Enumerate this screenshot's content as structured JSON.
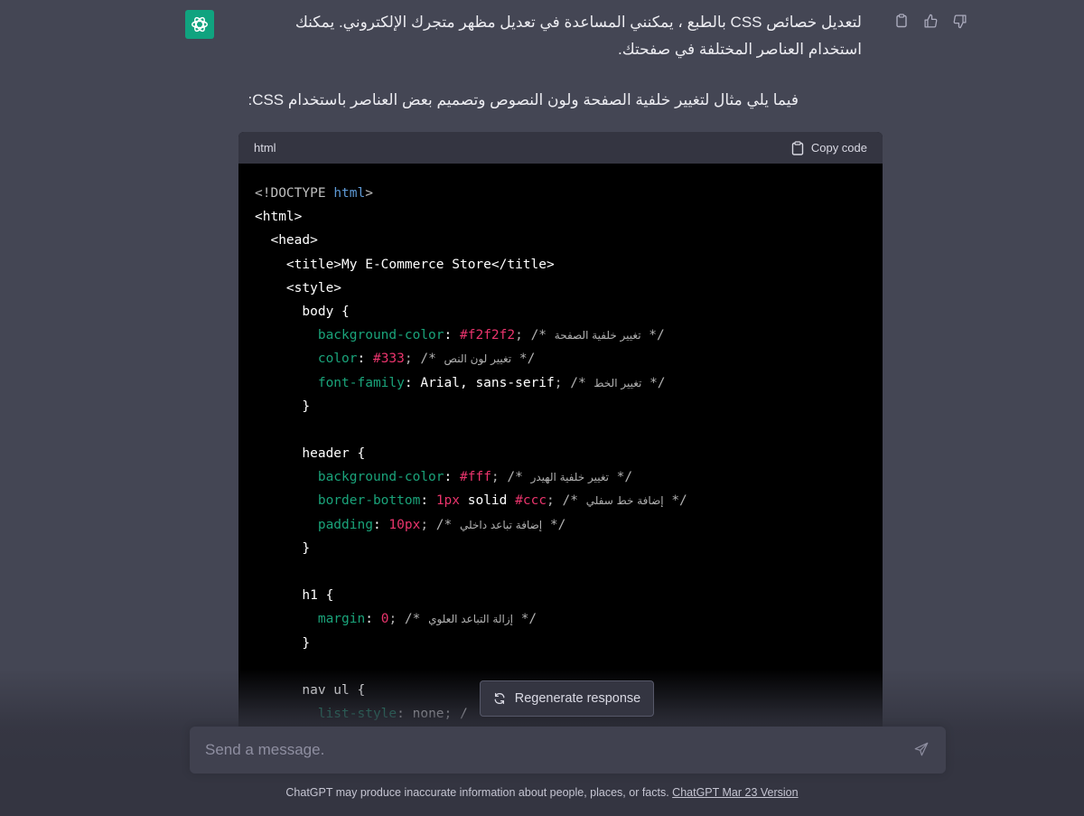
{
  "message": {
    "paragraph_1": "لتعديل خصائص CSS بالطبع ، يمكنني المساعدة في تعديل مظهر متجرك الإلكتروني. يمكنك استخدام العناصر المختلفة في صفحتك.",
    "paragraph_2": "فيما يلي مثال لتغيير خلفية الصفحة ولون النصوص وتصميم بعض العناصر باستخدام CSS:",
    "icons": [
      "openai-logo-icon",
      "clipboard-icon",
      "thumbs-up-icon",
      "thumbs-down-icon"
    ]
  },
  "code_block": {
    "language": "html",
    "copy_label": "Copy code",
    "lines": [
      [
        {
          "t": "<!DOCTYPE ",
          "c": "gray"
        },
        {
          "t": "html",
          "c": "blue"
        },
        {
          "t": ">",
          "c": "gray"
        }
      ],
      [
        {
          "t": "<html>",
          "c": "tag"
        }
      ],
      [
        {
          "t": "  <head>",
          "c": "tag"
        }
      ],
      [
        {
          "t": "    <title>My E-Commerce Store</title>",
          "c": "tag"
        }
      ],
      [
        {
          "t": "    <style>",
          "c": "tag"
        }
      ],
      [
        {
          "t": "      body {",
          "c": "plain"
        }
      ],
      [
        {
          "t": "        ",
          "c": "plain"
        },
        {
          "t": "background-color",
          "c": "prop"
        },
        {
          "t": ": ",
          "c": "plain"
        },
        {
          "t": "#f2f2f2",
          "c": "val"
        },
        {
          "t": "; /* ",
          "c": "cmt"
        },
        {
          "t": "تغيير خلفية الصفحة",
          "c": "ar"
        },
        {
          "t": " */",
          "c": "cmt"
        }
      ],
      [
        {
          "t": "        ",
          "c": "plain"
        },
        {
          "t": "color",
          "c": "prop"
        },
        {
          "t": ": ",
          "c": "plain"
        },
        {
          "t": "#333",
          "c": "val"
        },
        {
          "t": "; /* ",
          "c": "cmt"
        },
        {
          "t": "تغيير لون النص",
          "c": "ar"
        },
        {
          "t": " */",
          "c": "cmt"
        }
      ],
      [
        {
          "t": "        ",
          "c": "plain"
        },
        {
          "t": "font-family",
          "c": "prop"
        },
        {
          "t": ": Arial, sans-serif",
          "c": "kw"
        },
        {
          "t": "; /* ",
          "c": "cmt"
        },
        {
          "t": "تغيير الخط",
          "c": "ar"
        },
        {
          "t": " */",
          "c": "cmt"
        }
      ],
      [
        {
          "t": "      }",
          "c": "plain"
        }
      ],
      [
        {
          "t": "",
          "c": "plain"
        }
      ],
      [
        {
          "t": "      header {",
          "c": "plain"
        }
      ],
      [
        {
          "t": "        ",
          "c": "plain"
        },
        {
          "t": "background-color",
          "c": "prop"
        },
        {
          "t": ": ",
          "c": "plain"
        },
        {
          "t": "#fff",
          "c": "val"
        },
        {
          "t": "; /* ",
          "c": "cmt"
        },
        {
          "t": "تغيير خلفية الهيدر",
          "c": "ar"
        },
        {
          "t": " */",
          "c": "cmt"
        }
      ],
      [
        {
          "t": "        ",
          "c": "plain"
        },
        {
          "t": "border-bottom",
          "c": "prop"
        },
        {
          "t": ": ",
          "c": "plain"
        },
        {
          "t": "1px",
          "c": "val"
        },
        {
          "t": " solid ",
          "c": "kw"
        },
        {
          "t": "#ccc",
          "c": "val"
        },
        {
          "t": "; /* ",
          "c": "cmt"
        },
        {
          "t": "إضافة خط سفلي",
          "c": "ar"
        },
        {
          "t": " */",
          "c": "cmt"
        }
      ],
      [
        {
          "t": "        ",
          "c": "plain"
        },
        {
          "t": "padding",
          "c": "prop"
        },
        {
          "t": ": ",
          "c": "plain"
        },
        {
          "t": "10px",
          "c": "val"
        },
        {
          "t": "; /* ",
          "c": "cmt"
        },
        {
          "t": "إضافة تباعد داخلي",
          "c": "ar"
        },
        {
          "t": " */",
          "c": "cmt"
        }
      ],
      [
        {
          "t": "      }",
          "c": "plain"
        }
      ],
      [
        {
          "t": "",
          "c": "plain"
        }
      ],
      [
        {
          "t": "      h1 {",
          "c": "plain"
        }
      ],
      [
        {
          "t": "        ",
          "c": "plain"
        },
        {
          "t": "margin",
          "c": "prop"
        },
        {
          "t": ": ",
          "c": "plain"
        },
        {
          "t": "0",
          "c": "val"
        },
        {
          "t": "; /* ",
          "c": "cmt"
        },
        {
          "t": "إزالة التباعد العلوي",
          "c": "ar"
        },
        {
          "t": " */",
          "c": "cmt"
        }
      ],
      [
        {
          "t": "      }",
          "c": "plain"
        }
      ],
      [
        {
          "t": "",
          "c": "plain"
        }
      ],
      [
        {
          "t": "      nav ul {",
          "c": "plain"
        }
      ],
      [
        {
          "t": "        ",
          "c": "plain"
        },
        {
          "t": "list-style",
          "c": "prop"
        },
        {
          "t": ": none; /",
          "c": "plain"
        }
      ]
    ]
  },
  "regenerate_label": "Regenerate response",
  "composer": {
    "placeholder": "Send a message."
  },
  "footer": {
    "text": "ChatGPT may produce inaccurate information about people, places, or facts. ",
    "link": "ChatGPT Mar 23 Version"
  },
  "colors": {
    "background": "#444654",
    "code_bg": "#000000",
    "accent": "#10a37f"
  }
}
